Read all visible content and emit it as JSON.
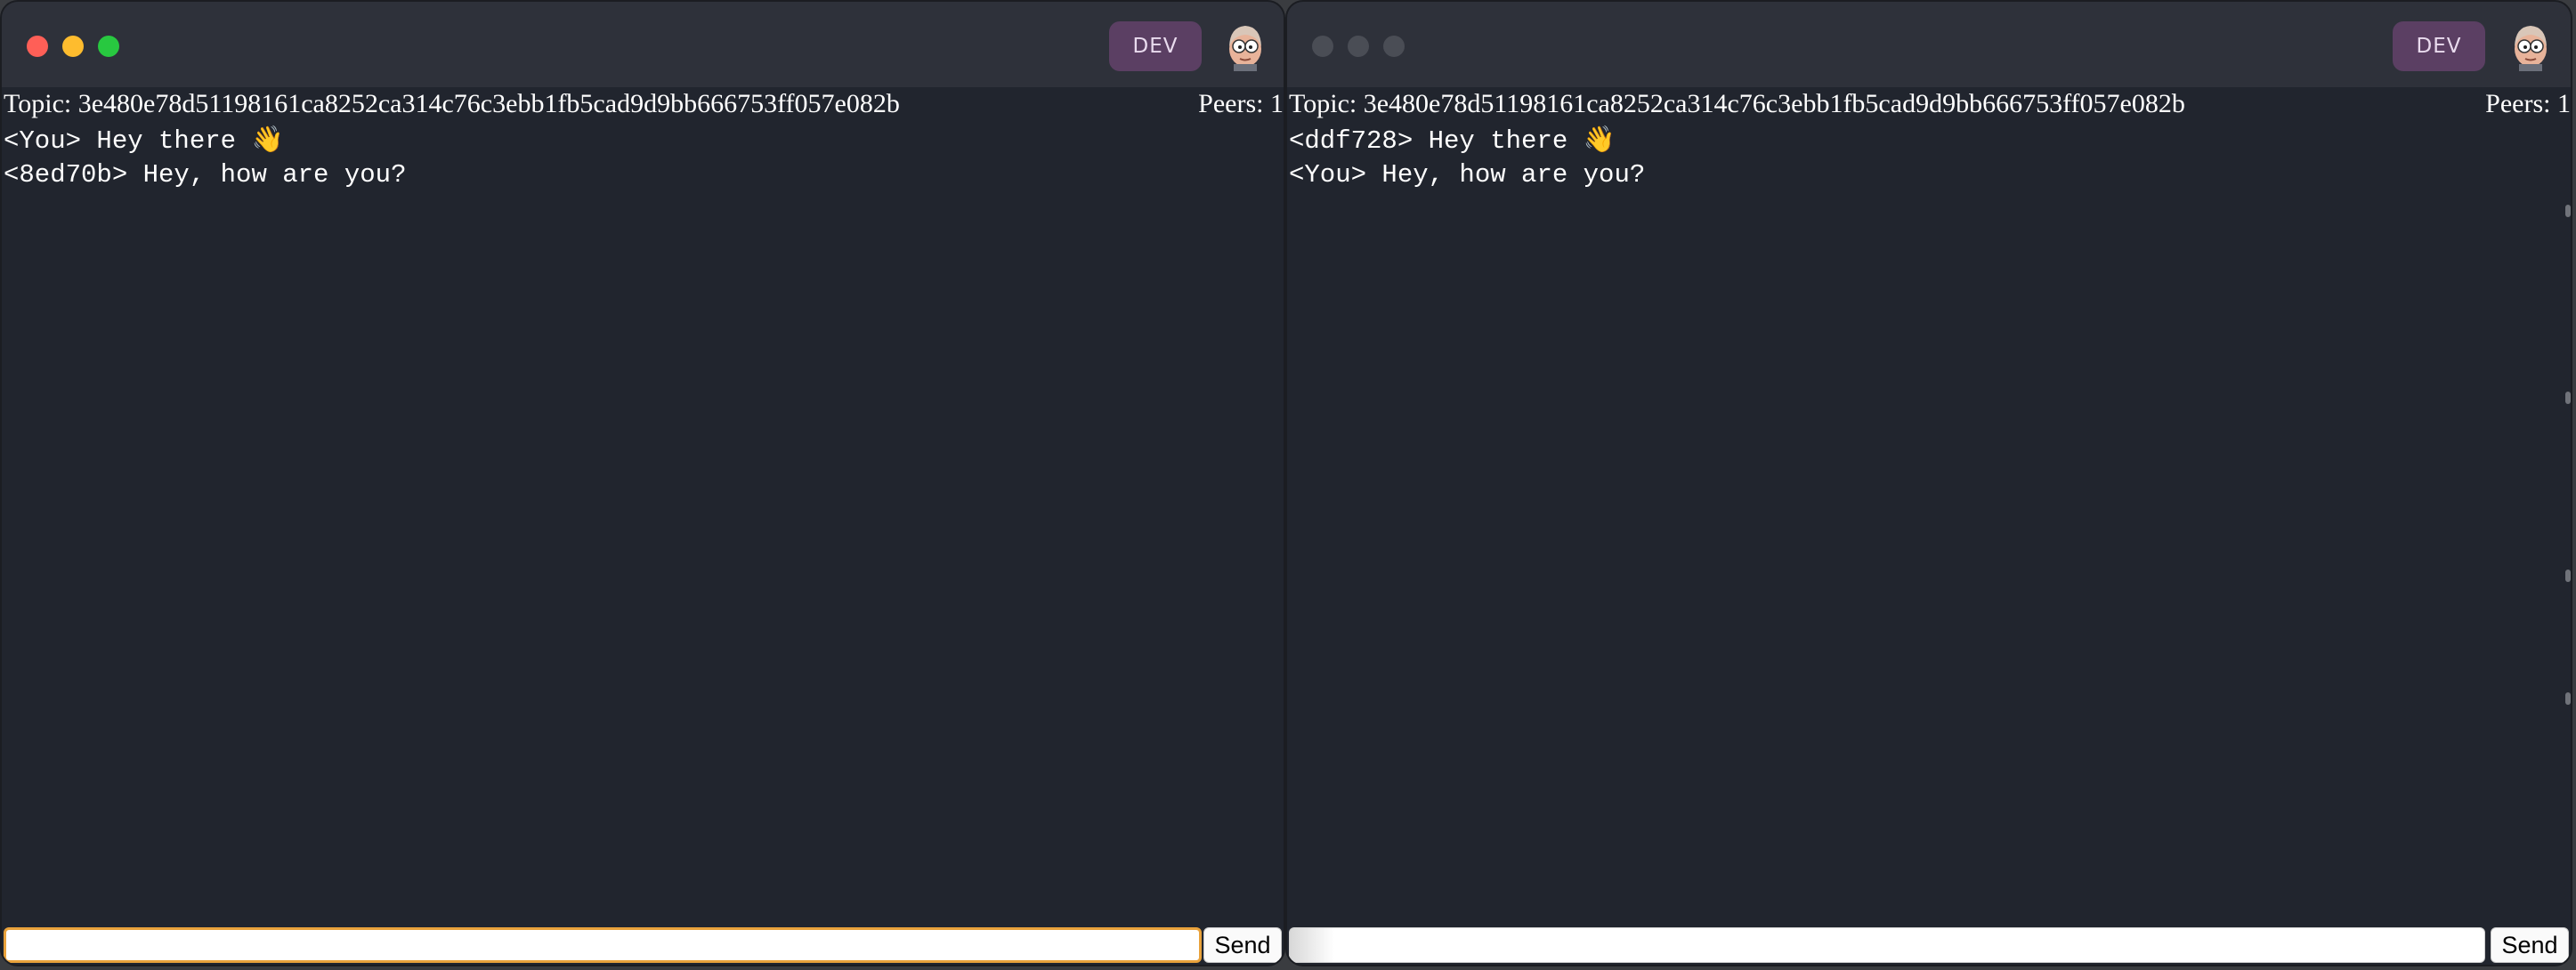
{
  "colors": {
    "close_active": "#ff5f57",
    "minimize_active": "#febc2e",
    "zoom_active": "#28c840",
    "light_inactive": "#4a4d55",
    "accent_focus": "#e9a23b",
    "dev_badge": "#5b3f63"
  },
  "windows": [
    {
      "dev_badge": "DEV",
      "avatar_icon": "cartoon-avatar-icon",
      "topic": "Topic: 3e480e78d51198161ca8252ca314c76c3ebb1fb5cad9d9bb666753ff057e082b",
      "peers": "Peers: 1",
      "messages": [
        {
          "text": "<You> Hey there 👋"
        },
        {
          "text": "<8ed70b> Hey, how are you?"
        }
      ],
      "input": {
        "value": "",
        "placeholder": ""
      },
      "send_label": "Send"
    },
    {
      "dev_badge": "DEV",
      "avatar_icon": "cartoon-avatar-icon",
      "topic": "Topic: 3e480e78d51198161ca8252ca314c76c3ebb1fb5cad9d9bb666753ff057e082b",
      "peers": "Peers: 1",
      "messages": [
        {
          "text": "<ddf728> Hey there 👋"
        },
        {
          "text": "<You> Hey, how are you?"
        }
      ],
      "input": {
        "value": "",
        "placeholder": ""
      },
      "send_label": "Send"
    }
  ]
}
